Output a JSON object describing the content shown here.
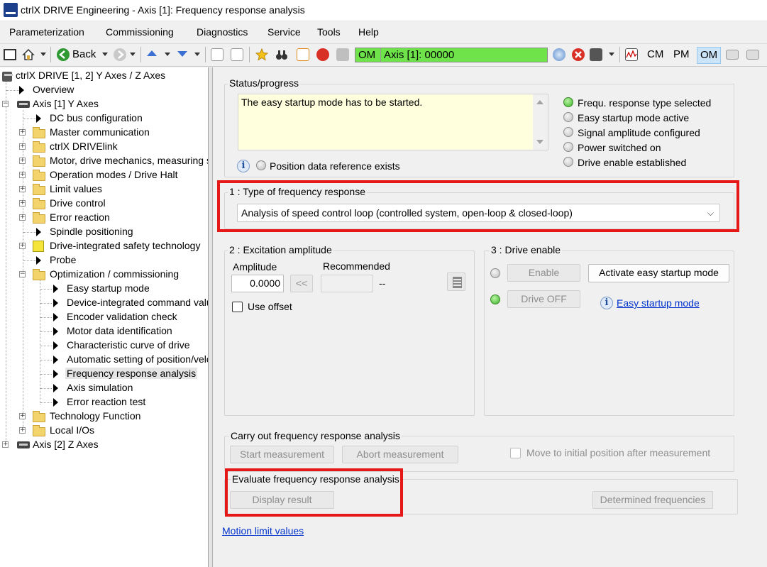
{
  "window": {
    "title": "ctrlX DRIVE Engineering - Axis [1]: Frequency response analysis"
  },
  "menu": [
    "Parameterization",
    "Commissioning",
    "Diagnostics",
    "Service",
    "Tools",
    "Help"
  ],
  "toolbar": {
    "back_label": "Back",
    "om_short": "OM",
    "axis_status": "Axis [1]:  00000",
    "modes": [
      "CM",
      "PM",
      "OM"
    ],
    "active_mode": "OM",
    "status_color": "#6fe34a"
  },
  "tree": {
    "root": "ctrlX DRIVE [1, 2] Y Axes / Z Axes",
    "items": [
      {
        "label": "Overview"
      },
      {
        "label": "Axis [1] Y Axes"
      },
      {
        "label": "DC bus configuration"
      },
      {
        "label": "Master communication"
      },
      {
        "label": "ctrlX DRIVElink"
      },
      {
        "label": "Motor, drive mechanics, measuring sy"
      },
      {
        "label": "Operation modes / Drive Halt"
      },
      {
        "label": "Limit values"
      },
      {
        "label": "Drive control"
      },
      {
        "label": "Error reaction"
      },
      {
        "label": "Spindle positioning"
      },
      {
        "label": "Drive-integrated safety technology"
      },
      {
        "label": "Probe"
      },
      {
        "label": "Optimization / commissioning"
      },
      {
        "label": "Easy startup mode"
      },
      {
        "label": "Device-integrated command valu"
      },
      {
        "label": "Encoder validation check"
      },
      {
        "label": "Motor data identification"
      },
      {
        "label": "Characteristic curve of drive"
      },
      {
        "label": "Automatic setting of position/velo"
      },
      {
        "label": "Frequency response analysis"
      },
      {
        "label": "Axis simulation"
      },
      {
        "label": "Error reaction test"
      },
      {
        "label": "Technology Function"
      },
      {
        "label": "Local I/Os"
      },
      {
        "label": "Axis [2] Z Axes"
      }
    ],
    "selected": "Frequency response analysis"
  },
  "status": {
    "group_title": "Status/progress",
    "message": "The easy startup mode has to be started.",
    "position_ref_label": "Position data reference exists",
    "indicators": [
      {
        "label": "Frequ. response type selected",
        "on": true
      },
      {
        "label": "Easy startup mode active",
        "on": false
      },
      {
        "label": "Signal amplitude configured",
        "on": false
      },
      {
        "label": "Power switched on",
        "on": false
      },
      {
        "label": "Drive enable established",
        "on": false
      }
    ]
  },
  "freq_type": {
    "group_title": "1 : Type of frequency response",
    "selected": "Analysis of speed control loop (controlled system, open-loop & closed-loop)"
  },
  "excitation": {
    "group_title": "2 : Excitation amplitude",
    "amplitude_label": "Amplitude",
    "recommended_label": "Recommended",
    "amplitude_value": "0.0000",
    "copy_label": "<<",
    "recommended_value": "",
    "recommended_unit": "--",
    "use_offset_label": "Use offset"
  },
  "drive_enable": {
    "group_title": "3 : Drive enable",
    "enable_label": "Enable",
    "drive_off_label": "Drive OFF",
    "activate_label": "Activate easy startup mode",
    "easy_link": "Easy startup mode"
  },
  "carry_out": {
    "group_title": "Carry out frequency response analysis",
    "start_label": "Start measurement",
    "abort_label": "Abort measurement",
    "move_label": "Move to initial position after measurement"
  },
  "evaluate": {
    "group_title": "Evaluate frequency response analysis",
    "display_label": "Display result",
    "determined_label": "Determined frequencies"
  },
  "footer_link": "Motion limit values"
}
